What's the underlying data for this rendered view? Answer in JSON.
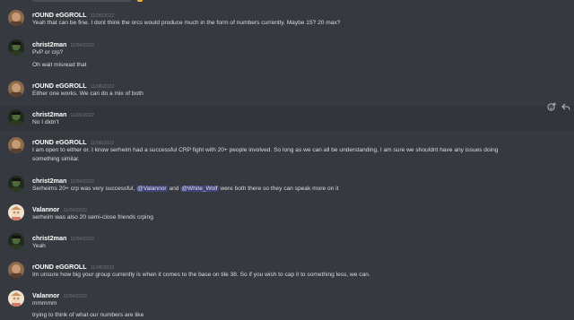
{
  "messages": [
    {
      "author": "rOUND eGGROLL",
      "time": "11/06/2022",
      "avatar": "eggroll",
      "lines": [
        "Yeah that can be fine. I dont think the orcs would produce much in the form of numbers currently. Maybe 15? 20 max?"
      ]
    },
    {
      "author": "christ2man",
      "time": "11/06/2022",
      "avatar": "christ",
      "lines": [
        "PvP or crp?",
        "Oh wait misread that"
      ]
    },
    {
      "author": "rOUND eGGROLL",
      "time": "11/06/2022",
      "avatar": "eggroll",
      "lines": [
        "Either one works. We can do a mix of both"
      ]
    },
    {
      "author": "christ2man",
      "time": "11/06/2022",
      "avatar": "christ",
      "lines": [
        "No I didn't"
      ]
    },
    {
      "author": "rOUND eGGROLL",
      "time": "11/06/2022",
      "avatar": "eggroll",
      "lines": [
        "I am open to either or. I know serheim had a successful CRP fight with 20+ people involved. So long as we can all be understanding, I am sure we shouldnt have any issues doing",
        "something similar."
      ]
    },
    {
      "author": "christ2man",
      "time": "11/06/2022",
      "avatar": "christ",
      "lines": [
        "Serheims 20+ crp was very successful,"
      ],
      "mention1": "@Valannor",
      "middle": "and",
      "mention2": "@White_Wolf",
      "tail": "were both there so they can speak more on it"
    },
    {
      "author": "Valannor",
      "time": "11/06/2022",
      "avatar": "valannor",
      "lines": [
        "serheim was also 20 semi-close friends crping"
      ]
    },
    {
      "author": "christ2man",
      "time": "11/06/2022",
      "avatar": "christ",
      "lines": [
        "Yeah"
      ]
    },
    {
      "author": "rOUND eGGROLL",
      "time": "11/06/2022",
      "avatar": "eggroll",
      "lines": [
        "Im unsure how big your group currently is when it comes to the base on tile 38. So if you wish to cap it to something less, we can."
      ]
    },
    {
      "author": "Valannor",
      "time": "11/06/2022",
      "avatar": "valannor",
      "lines": [
        "mmmmm",
        "trying to think of what our numbers are like"
      ]
    }
  ],
  "colors": {
    "background": "#36393f",
    "hover_row": "#32353b",
    "author": "#ffffff",
    "timestamp": "#72767d",
    "text": "#dcddde",
    "mention_bg": "#414675",
    "mention_text": "#dee0fc"
  },
  "hover_actions": [
    "add-reaction-icon",
    "reply-icon"
  ]
}
